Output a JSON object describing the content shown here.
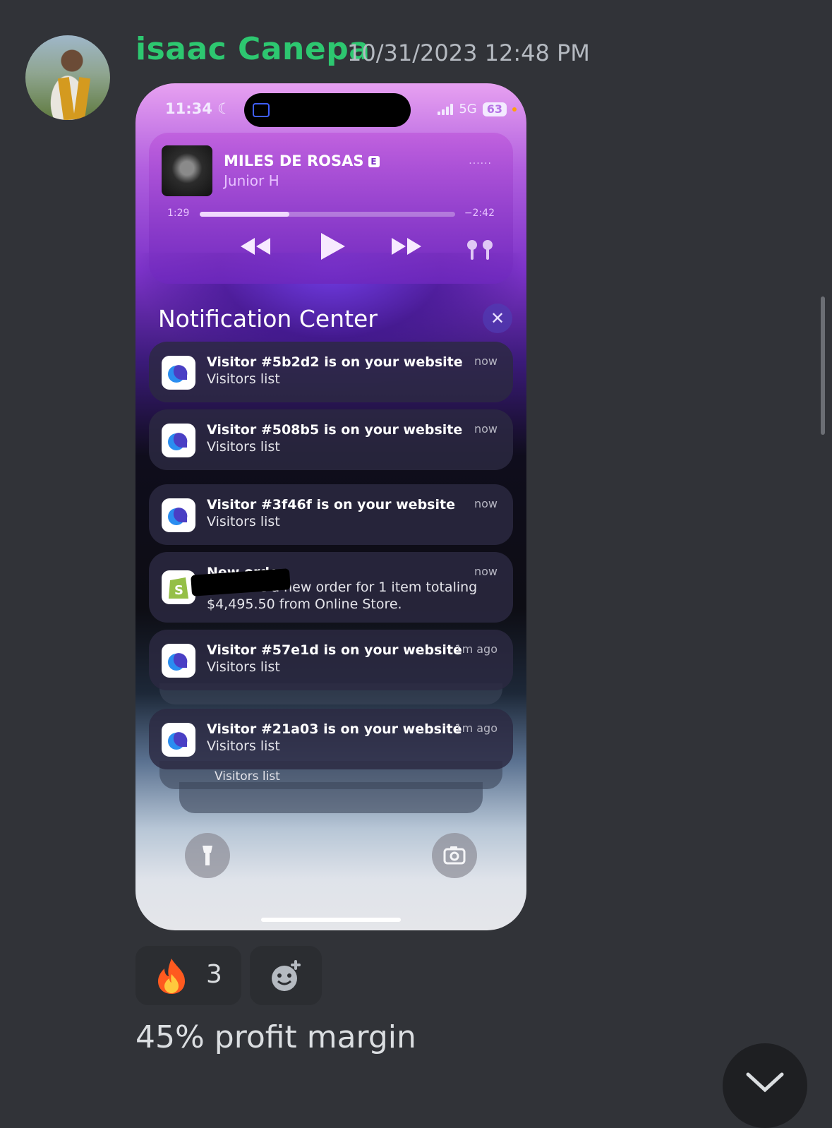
{
  "message": {
    "author": "isaac Canepa",
    "author_color": "#2dc770",
    "timestamp": "10/31/2023 12:48 PM",
    "text": "45% profit margin",
    "reactions": [
      {
        "emoji": "fire-icon",
        "count": "3"
      },
      {
        "emoji": "add-reaction-icon"
      }
    ]
  },
  "screenshot": {
    "status_bar": {
      "time": "11:34",
      "network": "5G",
      "battery": "63"
    },
    "now_playing": {
      "song": "MILES DE ROSAS",
      "explicit": "E",
      "artist": "Junior H",
      "elapsed": "1:29",
      "remaining": "−2:42",
      "progress": 0.35
    },
    "notification_center": {
      "title": "Notification Center",
      "notifications": [
        {
          "title": "Visitor #5b2d2 is on your website",
          "subtitle": "Visitors list",
          "time": "now"
        },
        {
          "title": "Visitor #508b5 is on your website",
          "subtitle": "Visitors list",
          "time": "now"
        },
        {
          "title": "Visitor #3f46f is on your website",
          "subtitle": "Visitors list",
          "time": "now"
        },
        {
          "title": "New order",
          "body": "You have a new order for 1 item totaling $4,495.50 from Online Store.",
          "time": "now"
        },
        {
          "title": "Visitor #57e1d is on your website",
          "subtitle": "Visitors list",
          "time": "1m ago"
        },
        {
          "title": "Visitor #21a03 is on your website",
          "subtitle": "Visitors list",
          "time": "1m ago"
        }
      ],
      "stacked_partial": "Visitors list"
    }
  }
}
